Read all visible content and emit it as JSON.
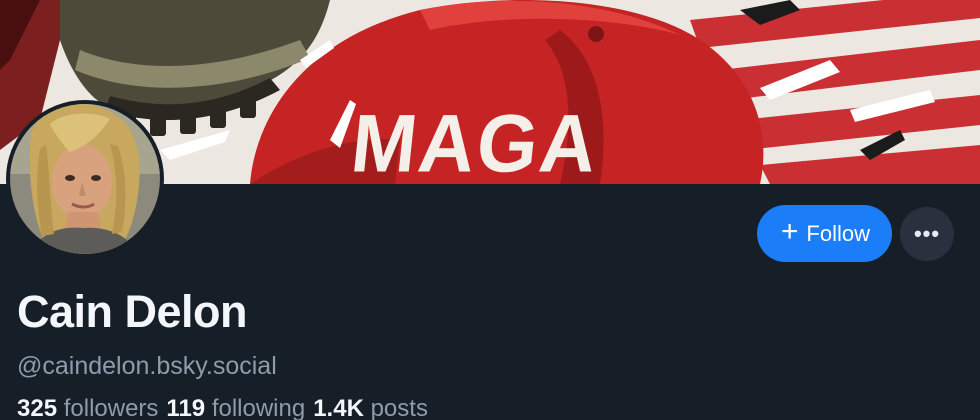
{
  "banner": {
    "hat_text": "MAGA"
  },
  "profile": {
    "display_name": "Cain Delon",
    "handle": "@caindelon.bsky.social",
    "stats": {
      "followers_count": "325",
      "followers_label": "followers",
      "following_count": "119",
      "following_label": "following",
      "posts_count": "1.4K",
      "posts_label": "posts"
    }
  },
  "actions": {
    "follow_label": "Follow",
    "follow_icon": "plus-icon",
    "more_icon": "ellipsis-icon",
    "more_glyph": "•••"
  },
  "colors": {
    "background": "#161e27",
    "accent": "#1b7df8",
    "muted_text": "#8f9bab",
    "primary_text": "#f3f6fa"
  }
}
